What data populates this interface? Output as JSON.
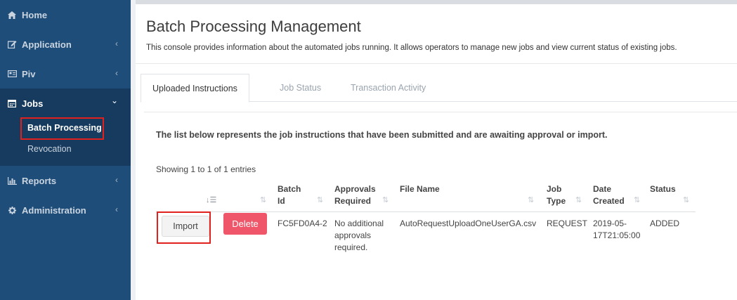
{
  "sidebar": {
    "items": [
      {
        "label": "Home",
        "icon": "home-icon"
      },
      {
        "label": "Application",
        "icon": "edit-icon",
        "chevron": "‹"
      },
      {
        "label": "Piv",
        "icon": "id-card-icon",
        "chevron": "‹"
      },
      {
        "label": "Jobs",
        "icon": "calendar-icon",
        "chevron": "⌄"
      },
      {
        "label": "Reports",
        "icon": "bar-chart-icon",
        "chevron": "‹"
      },
      {
        "label": "Administration",
        "icon": "gear-icon",
        "chevron": "‹"
      }
    ],
    "jobs_sub": [
      "Batch Processing",
      "Revocation"
    ]
  },
  "page": {
    "title": "Batch Processing Management",
    "subtitle": "This console provides information about the automated jobs running. It allows operators to manage new jobs and view current status of existing jobs."
  },
  "tabs": [
    "Uploaded Instructions",
    "Job Status",
    "Transaction Activity"
  ],
  "panel": {
    "intro": "The list below represents the job instructions that have been submitted and are awaiting approval or import.",
    "showing": "Showing 1 to 1 of 1 entries"
  },
  "table": {
    "headers": {
      "batch_id": [
        "Batch",
        "Id"
      ],
      "approvals": [
        "Approvals",
        "Required"
      ],
      "file_name": "File Name",
      "job_type": [
        "Job",
        "Type"
      ],
      "date_created": [
        "Date",
        "Created"
      ],
      "status": "Status"
    },
    "row": {
      "import_label": "Import",
      "delete_label": "Delete",
      "batch_id": "FC5FD0A4-2",
      "approvals": [
        "No additional",
        "approvals",
        "required."
      ],
      "file_name": "AutoRequestUploadOneUserGA.csv",
      "job_type": "REQUEST",
      "date_created": [
        "2019-05-",
        "17T21:05:00"
      ],
      "status": "ADDED"
    }
  },
  "colors": {
    "sidebar": "#1f4d7a",
    "sidebar_active": "#173b5e",
    "highlight": "#e0211e",
    "delete": "#f0566a"
  }
}
